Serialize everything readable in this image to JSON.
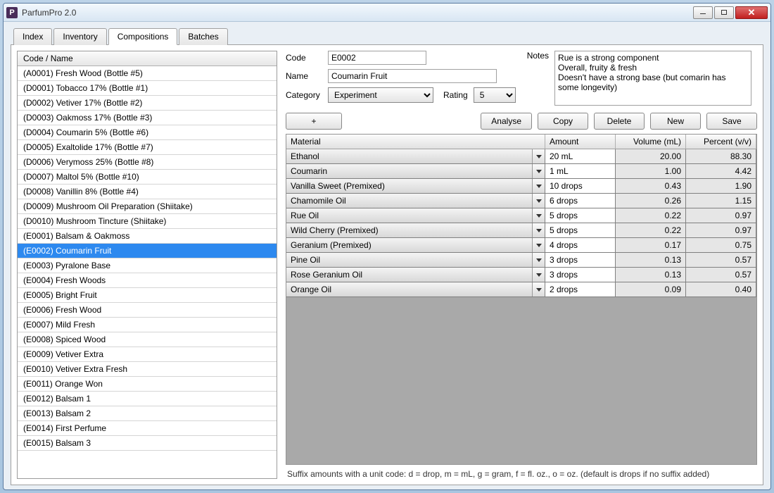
{
  "window": {
    "title": "ParfumPro 2.0",
    "icon_letter": "P"
  },
  "tabs": [
    {
      "label": "Index"
    },
    {
      "label": "Inventory"
    },
    {
      "label": "Compositions"
    },
    {
      "label": "Batches"
    }
  ],
  "active_tab": 2,
  "list_header": "Code / Name",
  "compositions": [
    "(A0001) Fresh Wood (Bottle #5)",
    "(D0001) Tobacco 17% (Bottle #1)",
    "(D0002) Vetiver 17% (Bottle #2)",
    "(D0003) Oakmoss 17% (Bottle #3)",
    "(D0004) Coumarin 5% (Bottle #6)",
    "(D0005) Exaltolide 17% (Bottle #7)",
    "(D0006) Verymoss 25% (Bottle #8)",
    "(D0007) Maltol 5% (Bottle #10)",
    "(D0008) Vanillin 8% (Bottle #4)",
    "(D0009) Mushroom Oil Preparation (Shiitake)",
    "(D0010) Mushroom Tincture (Shiitake)",
    "(E0001) Balsam & Oakmoss",
    "(E0002) Coumarin Fruit",
    "(E0003) Pyralone Base",
    "(E0004) Fresh Woods",
    "(E0005) Bright Fruit",
    "(E0006) Fresh Wood",
    "(E0007) Mild Fresh",
    "(E0008) Spiced Wood",
    "(E0009) Vetiver Extra",
    "(E0010) Vetiver Extra Fresh",
    "(E0011) Orange Won",
    "(E0012) Balsam 1",
    "(E0013) Balsam 2",
    "(E0014) First Perfume",
    "(E0015) Balsam 3"
  ],
  "selected_composition_index": 12,
  "form": {
    "labels": {
      "code": "Code",
      "name": "Name",
      "category": "Category",
      "rating": "Rating",
      "notes": "Notes"
    },
    "code": "E0002",
    "name": "Coumarin Fruit",
    "category": "Experiment",
    "rating": "5",
    "notes": "Rue is a strong component\nOverall, fruity & fresh\nDoesn't have a strong base (but comarin has some longevity)"
  },
  "buttons": {
    "add": "+",
    "analyse": "Analyse",
    "copy": "Copy",
    "delete": "Delete",
    "new": "New",
    "save": "Save"
  },
  "grid": {
    "headers": {
      "material": "Material",
      "amount": "Amount",
      "volume": "Volume (mL)",
      "percent": "Percent (v/v)"
    },
    "rows": [
      {
        "material": "Ethanol",
        "amount": "20 mL",
        "volume": "20.00",
        "percent": "88.30"
      },
      {
        "material": "Coumarin",
        "amount": "1 mL",
        "volume": "1.00",
        "percent": "4.42"
      },
      {
        "material": "Vanilla Sweet (Premixed)",
        "amount": "10 drops",
        "volume": "0.43",
        "percent": "1.90"
      },
      {
        "material": "Chamomile Oil",
        "amount": "6 drops",
        "volume": "0.26",
        "percent": "1.15"
      },
      {
        "material": "Rue Oil",
        "amount": "5 drops",
        "volume": "0.22",
        "percent": "0.97"
      },
      {
        "material": "Wild Cherry (Premixed)",
        "amount": "5 drops",
        "volume": "0.22",
        "percent": "0.97"
      },
      {
        "material": "Geranium (Premixed)",
        "amount": "4 drops",
        "volume": "0.17",
        "percent": "0.75"
      },
      {
        "material": "Pine Oil",
        "amount": "3 drops",
        "volume": "0.13",
        "percent": "0.57"
      },
      {
        "material": "Rose Geranium Oil",
        "amount": "3 drops",
        "volume": "0.13",
        "percent": "0.57"
      },
      {
        "material": "Orange Oil",
        "amount": "2 drops",
        "volume": "0.09",
        "percent": "0.40"
      }
    ]
  },
  "footer_hint": "Suffix amounts with a unit code: d = drop, m = mL, g = gram, f = fl. oz., o = oz. (default is drops if no suffix added)"
}
